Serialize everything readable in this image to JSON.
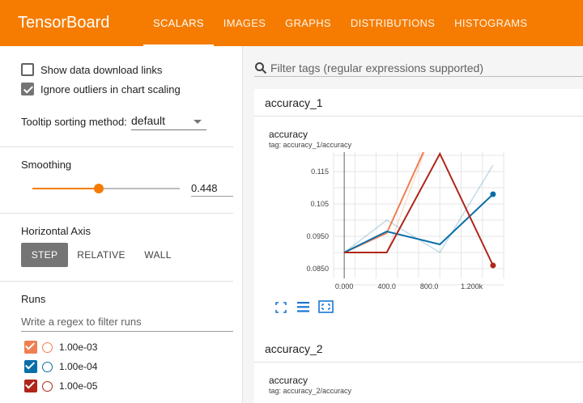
{
  "app": {
    "title": "TensorBoard"
  },
  "nav": {
    "tabs": [
      {
        "label": "SCALARS"
      },
      {
        "label": "IMAGES"
      },
      {
        "label": "GRAPHS"
      },
      {
        "label": "DISTRIBUTIONS"
      },
      {
        "label": "HISTOGRAMS"
      }
    ]
  },
  "sidebar": {
    "options": {
      "show_download": "Show data download links",
      "ignore_outliers": "Ignore outliers in chart scaling",
      "tooltip_label": "Tooltip sorting method:",
      "tooltip_value": "default"
    },
    "smoothing": {
      "label": "Smoothing",
      "value": "0.448",
      "fraction": 0.448
    },
    "horizontal_axis": {
      "label": "Horizontal Axis",
      "options": [
        "STEP",
        "RELATIVE",
        "WALL"
      ],
      "selected": "STEP"
    },
    "runs": {
      "label": "Runs",
      "filter_placeholder": "Write a regex to filter runs",
      "items": [
        {
          "name": "1.00e-03",
          "color": "#ef7f51",
          "checked": true
        },
        {
          "name": "1.00e-04",
          "color": "#0a6ea8",
          "checked": true
        },
        {
          "name": "1.00e-05",
          "color": "#b0261a",
          "checked": true
        }
      ]
    }
  },
  "main": {
    "filter_placeholder": "Filter tags (regular expressions supported)",
    "groups": [
      {
        "name": "accuracy_1",
        "card_title": "accuracy",
        "card_tag": "tag: accuracy_1/accuracy"
      },
      {
        "name": "accuracy_2",
        "card_title": "accuracy",
        "card_tag": "tag: accuracy_2/accuracy"
      }
    ]
  },
  "chart_data": {
    "type": "line",
    "xlim": [
      -100,
      1500
    ],
    "ylim": [
      0.082,
      0.121
    ],
    "x_ticks": [
      0,
      400,
      800,
      1200
    ],
    "x_tick_labels": [
      "0.000",
      "400.0",
      "800.0",
      "1.200k"
    ],
    "y_ticks": [
      0.085,
      0.095,
      0.105,
      0.115
    ],
    "y_tick_labels": [
      "0.0850",
      "0.0950",
      "0.105",
      "0.115"
    ],
    "grid": true,
    "series": [
      {
        "color": "#ef7f51",
        "raw": [
          [
            0,
            0.09
          ],
          [
            400,
            0.09
          ],
          [
            800,
            0.125
          ]
        ],
        "smoothed": [
          [
            0,
            0.09
          ],
          [
            400,
            0.096
          ],
          [
            800,
            0.125
          ]
        ]
      },
      {
        "color": "#0a6ea8",
        "raw": [
          [
            0,
            0.09
          ],
          [
            400,
            0.1
          ],
          [
            900,
            0.09
          ],
          [
            1400,
            0.117
          ]
        ],
        "smoothed": [
          [
            0,
            0.09
          ],
          [
            400,
            0.0965
          ],
          [
            900,
            0.0925
          ],
          [
            1400,
            0.108
          ]
        ]
      },
      {
        "color": "#b0261a",
        "raw": [
          [
            0,
            0.09
          ],
          [
            400,
            0.09
          ],
          [
            900,
            0.1205
          ],
          [
            1400,
            0.086
          ]
        ],
        "smoothed": [
          [
            0,
            0.09
          ],
          [
            400,
            0.09
          ],
          [
            900,
            0.1205
          ],
          [
            1400,
            0.086
          ]
        ]
      }
    ]
  }
}
